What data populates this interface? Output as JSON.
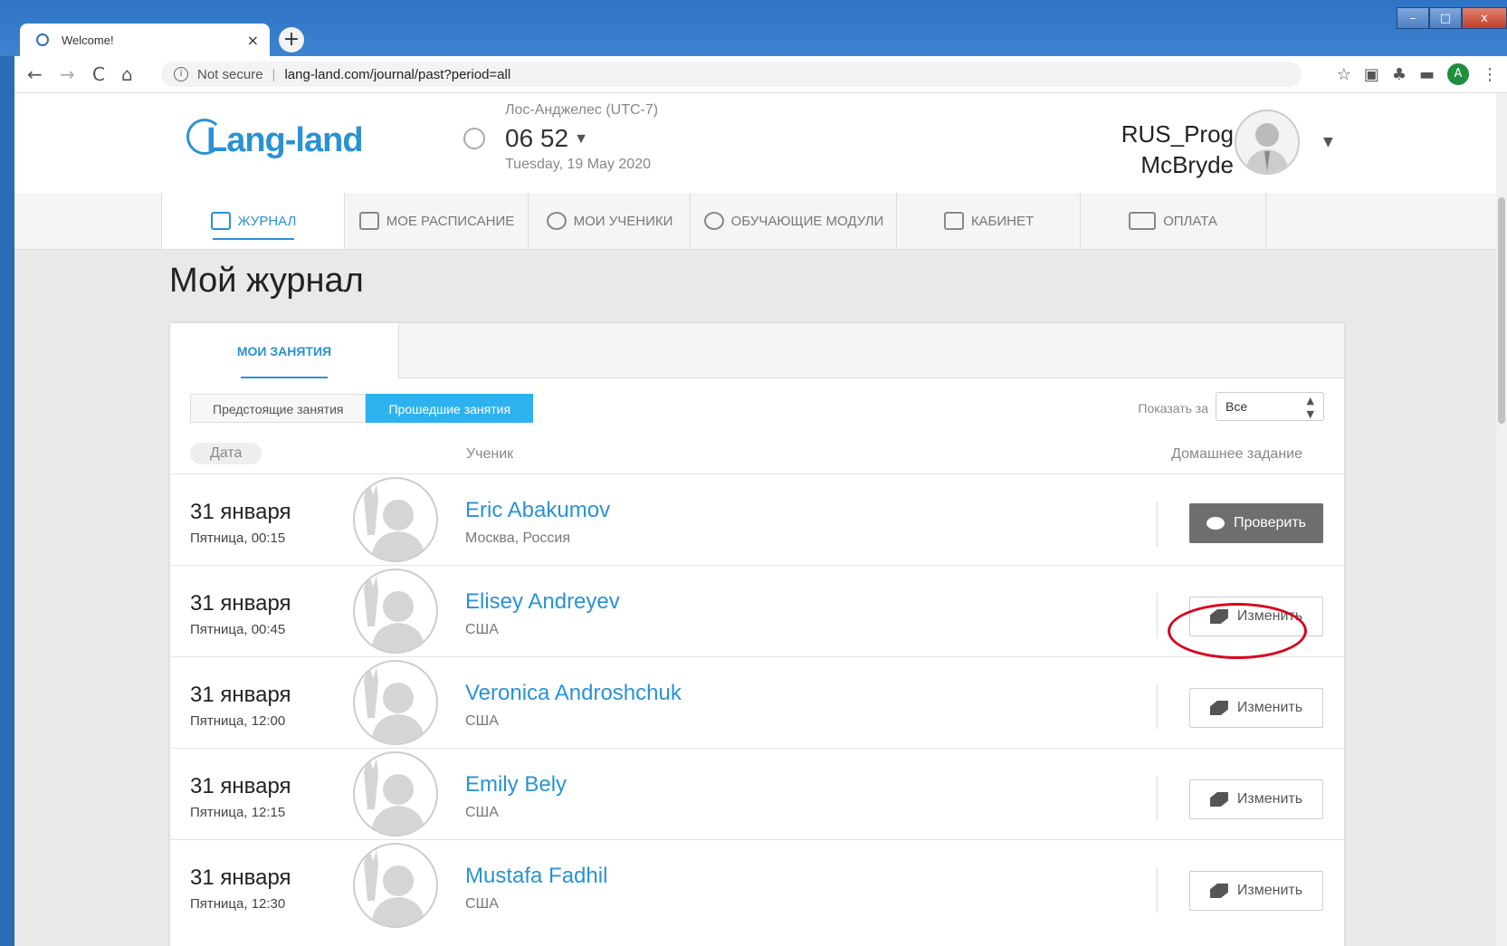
{
  "browser": {
    "tab_title": "Welcome!",
    "tab_close": "×",
    "new_tab": "+",
    "back": "←",
    "forward": "→",
    "reload": "C",
    "home": "⌂",
    "security_text": "Not secure",
    "url": "lang-land.com/journal/past?period=all",
    "profile_letter": "A",
    "window_controls": [
      "–",
      "□",
      "x"
    ]
  },
  "header": {
    "logo": "Lang-land",
    "timezone": "Лос-Анджелес (UTC-7)",
    "time": "06 52",
    "date": "Tuesday, 19 May 2020",
    "user_first": "RUS_Prog",
    "user_last": "McBryde"
  },
  "nav": {
    "items": [
      {
        "label": "ЖУРНАЛ",
        "icon": "journal-edit-icon",
        "active": true
      },
      {
        "label": "МОЕ РАСПИСАНИЕ",
        "icon": "calendar-icon"
      },
      {
        "label": "МОИ УЧЕНИКИ",
        "icon": "students-icon"
      },
      {
        "label": "ОБУЧАЮЩИЕ МОДУЛИ",
        "icon": "puzzle-icon"
      },
      {
        "label": "КАБИНЕТ",
        "icon": "cabinet-icon"
      },
      {
        "label": "ОПЛАТА",
        "icon": "payment-card-icon"
      }
    ]
  },
  "page_title": "Мой журнал",
  "card": {
    "tab": "МОИ ЗАНЯТИЯ",
    "segments": [
      "Предстоящие занятия",
      "Прошедшие занятия"
    ],
    "period_label": "Показать за",
    "period_value": "Все",
    "columns": {
      "date": "Дата",
      "student": "Ученик",
      "homework": "Домашнее задание"
    }
  },
  "lessons": [
    {
      "date": "31 января",
      "time": "Пятница, 00:15",
      "student": "Eric Abakumov",
      "location": "Москва, Россия",
      "action": "Проверить"
    },
    {
      "date": "31 января",
      "time": "Пятница, 00:45",
      "student": "Elisey Andreyev",
      "location": "США",
      "action": "Изменить"
    },
    {
      "date": "31 января",
      "time": "Пятница, 12:00",
      "student": "Veronica Androshchuk",
      "location": "США",
      "action": "Изменить"
    },
    {
      "date": "31 января",
      "time": "Пятница, 12:15",
      "student": "Emily Bely",
      "location": "США",
      "action": "Изменить"
    },
    {
      "date": "31 января",
      "time": "Пятница, 12:30",
      "student": "Mustafa Fadhil",
      "location": "США",
      "action": "Изменить"
    }
  ],
  "colors": {
    "accent": "#2a92d4",
    "segment_active": "#2db2f0",
    "highlight": "#d9001b"
  }
}
